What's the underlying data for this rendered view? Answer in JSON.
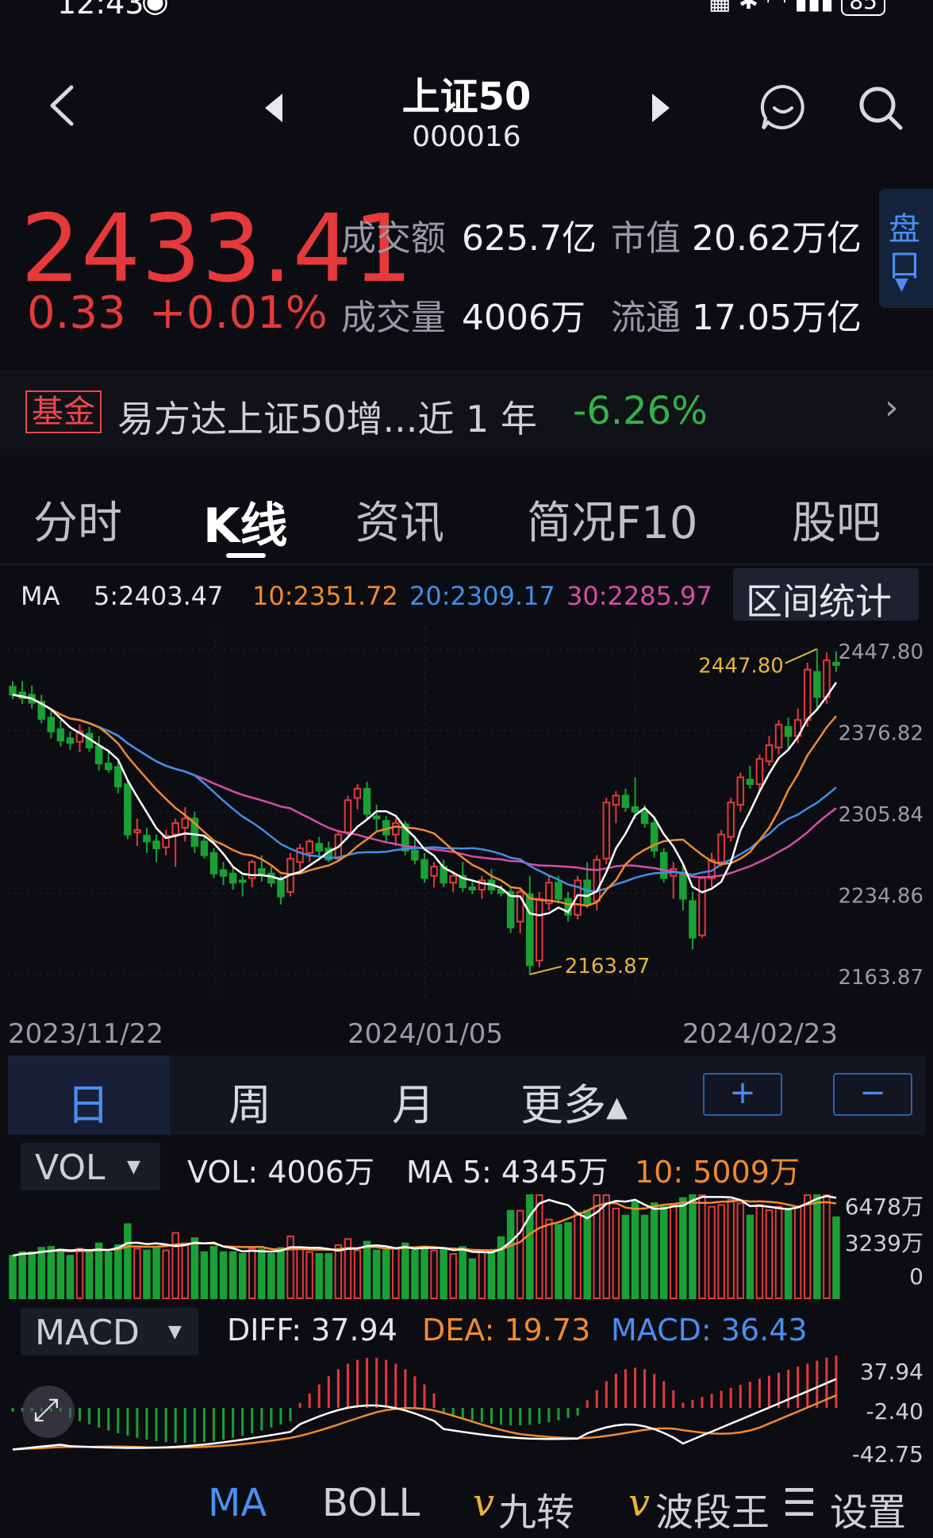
{
  "status": {
    "time": "12:43",
    "battery": "85"
  },
  "header": {
    "title": "上证50",
    "code": "000016"
  },
  "quote": {
    "price": "2433.41",
    "change_abs": "0.33",
    "change_pct": "+0.01%",
    "turnover_label": "成交额",
    "turnover": "625.7亿",
    "mktcap_label": "市值",
    "mktcap": "20.62万亿",
    "volume_label": "成交量",
    "volume": "4006万",
    "float_label": "流通",
    "float": "17.05万亿",
    "pankou_1": "盘",
    "pankou_2": "口"
  },
  "fund": {
    "badge": "基金",
    "name": "易方达上证50增...近 1 年",
    "pct": "-6.26%",
    "arrow": "›"
  },
  "tabs": [
    {
      "label": "分时"
    },
    {
      "label": "K线"
    },
    {
      "label": "资讯"
    },
    {
      "label": "简况F10"
    },
    {
      "label": "股吧"
    }
  ],
  "ma_row": {
    "label": "MA",
    "ma5": "5:2403.47",
    "ma10": "10:2351.72",
    "ma20": "20:2309.17",
    "ma30": "30:2285.97",
    "range_btn": "区间统计"
  },
  "kline": {
    "y_ticks": [
      "2447.80",
      "2376.82",
      "2305.84",
      "2234.86",
      "2163.87"
    ],
    "high_label": "2447.80",
    "low_label": "2163.87",
    "x_dates": [
      "2023/11/22",
      "2024/01/05",
      "2024/02/23"
    ]
  },
  "period": {
    "day": "日",
    "week": "周",
    "month": "月",
    "more": "更多▴",
    "plus": "+",
    "minus": "−"
  },
  "vol": {
    "selector": "VOL",
    "vol": "VOL:  4006万",
    "ma5": "MA 5:  4345万",
    "ma10": "10:  5009万",
    "y_ticks": [
      "6478万",
      "3239万",
      "0"
    ]
  },
  "macd": {
    "selector": "MACD",
    "diff": "DIFF:  37.94",
    "dea": "DEA:  19.73",
    "macd": "MACD:  36.43",
    "y_ticks": [
      "37.94",
      "-2.40",
      "-42.75"
    ]
  },
  "toolbar": {
    "ma": "MA",
    "boll": "BOLL",
    "jiuzhuan": "九转",
    "boduan": "波段王",
    "settings": "设置"
  },
  "colors": {
    "up": "#e5393c",
    "down": "#1aa035",
    "ma5": "#ffffff",
    "ma10": "#f08a2e",
    "ma20": "#3f8fe8",
    "ma30": "#d94ba8",
    "accent": "#4a8ef0"
  },
  "chart_data": {
    "type": "candlestick",
    "title": "",
    "y_axis_ticks": [
      2447.8,
      2376.82,
      2305.84,
      2234.86,
      2163.87
    ],
    "ylim": [
      2163.87,
      2447.8
    ],
    "x_dates": [
      "2023/11/22",
      "2024/01/05",
      "2024/02/23"
    ],
    "annotations": [
      {
        "label": "2447.80",
        "type": "high"
      },
      {
        "label": "2163.87",
        "type": "low"
      }
    ],
    "candles_ohlc": [
      [
        2415,
        2420,
        2404,
        2408
      ],
      [
        2410,
        2420,
        2400,
        2405
      ],
      [
        2408,
        2416,
        2396,
        2401
      ],
      [
        2402,
        2408,
        2383,
        2387
      ],
      [
        2388,
        2396,
        2370,
        2376
      ],
      [
        2378,
        2386,
        2363,
        2368
      ],
      [
        2370,
        2376,
        2360,
        2366
      ],
      [
        2367,
        2382,
        2358,
        2376
      ],
      [
        2374,
        2380,
        2358,
        2362
      ],
      [
        2363,
        2372,
        2342,
        2348
      ],
      [
        2348,
        2360,
        2340,
        2343
      ],
      [
        2345,
        2350,
        2322,
        2328
      ],
      [
        2330,
        2334,
        2282,
        2286
      ],
      [
        2288,
        2300,
        2276,
        2290
      ],
      [
        2285,
        2292,
        2270,
        2280
      ],
      [
        2280,
        2286,
        2262,
        2274
      ],
      [
        2275,
        2290,
        2268,
        2285
      ],
      [
        2286,
        2300,
        2258,
        2296
      ],
      [
        2292,
        2310,
        2280,
        2300
      ],
      [
        2300,
        2306,
        2270,
        2276
      ],
      [
        2280,
        2285,
        2265,
        2268
      ],
      [
        2270,
        2274,
        2248,
        2252
      ],
      [
        2255,
        2262,
        2242,
        2250
      ],
      [
        2252,
        2258,
        2238,
        2244
      ],
      [
        2246,
        2250,
        2232,
        2245
      ],
      [
        2248,
        2264,
        2240,
        2262
      ],
      [
        2256,
        2268,
        2245,
        2252
      ],
      [
        2252,
        2258,
        2240,
        2244
      ],
      [
        2246,
        2250,
        2225,
        2232
      ],
      [
        2236,
        2270,
        2232,
        2265
      ],
      [
        2262,
        2278,
        2254,
        2274
      ],
      [
        2270,
        2282,
        2262,
        2280
      ],
      [
        2278,
        2284,
        2266,
        2272
      ],
      [
        2274,
        2280,
        2262,
        2264
      ],
      [
        2265,
        2290,
        2262,
        2286
      ],
      [
        2288,
        2320,
        2285,
        2316
      ],
      [
        2318,
        2330,
        2308,
        2326
      ],
      [
        2326,
        2332,
        2300,
        2304
      ],
      [
        2302,
        2312,
        2290,
        2300
      ],
      [
        2298,
        2302,
        2280,
        2286
      ],
      [
        2286,
        2300,
        2276,
        2296
      ],
      [
        2295,
        2298,
        2268,
        2272
      ],
      [
        2272,
        2282,
        2260,
        2264
      ],
      [
        2264,
        2270,
        2244,
        2248
      ],
      [
        2250,
        2262,
        2240,
        2258
      ],
      [
        2258,
        2264,
        2240,
        2244
      ],
      [
        2244,
        2254,
        2236,
        2250
      ],
      [
        2250,
        2262,
        2236,
        2240
      ],
      [
        2240,
        2246,
        2234,
        2238
      ],
      [
        2238,
        2250,
        2230,
        2246
      ],
      [
        2246,
        2256,
        2234,
        2238
      ],
      [
        2238,
        2242,
        2232,
        2235
      ],
      [
        2236,
        2240,
        2200,
        2205
      ],
      [
        2210,
        2240,
        2200,
        2236
      ],
      [
        2234,
        2250,
        2164,
        2172
      ],
      [
        2176,
        2236,
        2170,
        2230
      ],
      [
        2226,
        2250,
        2220,
        2244
      ],
      [
        2244,
        2250,
        2226,
        2230
      ],
      [
        2230,
        2236,
        2210,
        2216
      ],
      [
        2216,
        2250,
        2212,
        2246
      ],
      [
        2246,
        2262,
        2222,
        2226
      ],
      [
        2228,
        2268,
        2220,
        2264
      ],
      [
        2265,
        2318,
        2260,
        2314
      ],
      [
        2312,
        2324,
        2296,
        2320
      ],
      [
        2320,
        2326,
        2306,
        2310
      ],
      [
        2310,
        2336,
        2300,
        2306
      ],
      [
        2306,
        2312,
        2292,
        2296
      ],
      [
        2296,
        2300,
        2266,
        2272
      ],
      [
        2270,
        2274,
        2244,
        2248
      ],
      [
        2250,
        2262,
        2230,
        2256
      ],
      [
        2252,
        2260,
        2220,
        2230
      ],
      [
        2228,
        2236,
        2186,
        2196
      ],
      [
        2198,
        2250,
        2196,
        2248
      ],
      [
        2248,
        2270,
        2240,
        2264
      ],
      [
        2262,
        2290,
        2258,
        2286
      ],
      [
        2284,
        2318,
        2280,
        2314
      ],
      [
        2312,
        2340,
        2306,
        2336
      ],
      [
        2334,
        2346,
        2326,
        2330
      ],
      [
        2330,
        2356,
        2324,
        2352
      ],
      [
        2350,
        2372,
        2346,
        2364
      ],
      [
        2362,
        2386,
        2356,
        2382
      ],
      [
        2380,
        2388,
        2360,
        2372
      ],
      [
        2372,
        2396,
        2366,
        2386
      ],
      [
        2386,
        2436,
        2380,
        2430
      ],
      [
        2428,
        2448,
        2396,
        2406
      ],
      [
        2406,
        2445,
        2400,
        2438
      ],
      [
        2436,
        2446,
        2428,
        2434
      ]
    ],
    "volume_ticks": [
      6478,
      3239,
      0
    ],
    "macd_ticks": [
      37.94,
      -2.4,
      -42.75
    ]
  }
}
